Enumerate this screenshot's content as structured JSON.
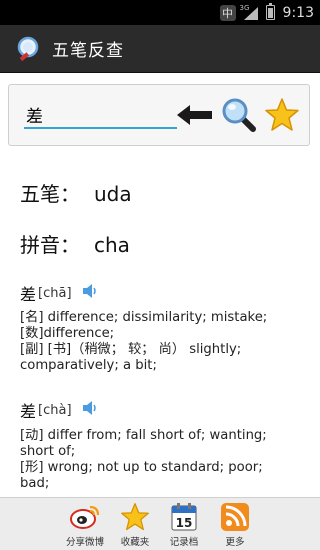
{
  "statusbar": {
    "ime": "中",
    "network": "3G",
    "time": "9:13"
  },
  "titlebar": {
    "title": "五笔反查"
  },
  "search": {
    "value": "差",
    "placeholder": ""
  },
  "result": {
    "wubi_label": "五笔：",
    "wubi_value": "uda",
    "pinyin_label": "拼音：",
    "pinyin_value": "cha"
  },
  "entries": [
    {
      "char": "差",
      "pinyin": "[chā]",
      "lines": [
        "[名] difference; dissimilarity; mistake;",
        "[数]difference;",
        "[副] [书]（稍微； 较； 尚） slightly; comparatively; a bit;"
      ]
    },
    {
      "char": "差",
      "pinyin": "[chà]",
      "lines": [
        "[动] differ from; fall short of; wanting; short of;",
        "[形] wrong; not up to standard; poor; bad;"
      ]
    }
  ],
  "bottombar": {
    "items": [
      {
        "label": "分享微博",
        "icon": "weibo-icon"
      },
      {
        "label": "收藏夹",
        "icon": "star-icon"
      },
      {
        "label": "记录档",
        "icon": "calendar-icon",
        "badge": "15"
      },
      {
        "label": "更多",
        "icon": "rss-icon"
      }
    ]
  },
  "colors": {
    "accent": "#33a3d6",
    "titlebar": "#2b2b2b",
    "star": "#f5b800"
  }
}
